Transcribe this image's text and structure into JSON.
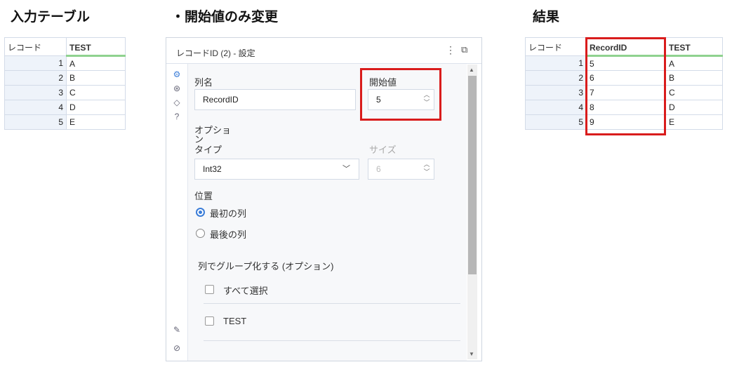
{
  "headings": {
    "input_table": "入力テーブル",
    "config": "・開始値のみ変更",
    "result": "結果"
  },
  "input_table": {
    "headers": [
      "レコード",
      "TEST"
    ],
    "rows": [
      {
        "num": "1",
        "test": "A"
      },
      {
        "num": "2",
        "test": "B"
      },
      {
        "num": "3",
        "test": "C"
      },
      {
        "num": "4",
        "test": "D"
      },
      {
        "num": "5",
        "test": "E"
      }
    ]
  },
  "panel": {
    "title": "レコードID (2) - 設定",
    "menu_icon": "kebab-menu-icon",
    "popout_icon": "popout-icon",
    "column_name_label": "列名",
    "column_name_value": "RecordID",
    "start_value_label": "開始値",
    "start_value": "5",
    "options_label": "オプション",
    "type_label": "タイプ",
    "type_value": "Int32",
    "size_label": "サイズ",
    "size_value": "6",
    "position_label": "位置",
    "position_first": "最初の列",
    "position_last": "最後の列",
    "group_label": "列でグループ化する (オプション)",
    "select_all": "すべて選択",
    "group_field": "TEST"
  },
  "result_table": {
    "headers": [
      "レコード",
      "RecordID",
      "TEST"
    ],
    "rows": [
      {
        "num": "1",
        "id": "5",
        "test": "A"
      },
      {
        "num": "2",
        "id": "6",
        "test": "B"
      },
      {
        "num": "3",
        "id": "7",
        "test": "C"
      },
      {
        "num": "4",
        "id": "8",
        "test": "D"
      },
      {
        "num": "5",
        "id": "9",
        "test": "E"
      }
    ]
  },
  "colors": {
    "highlight": "#d91c1c",
    "accent": "#3b7dd8",
    "header_underline": "#8fd28f"
  }
}
